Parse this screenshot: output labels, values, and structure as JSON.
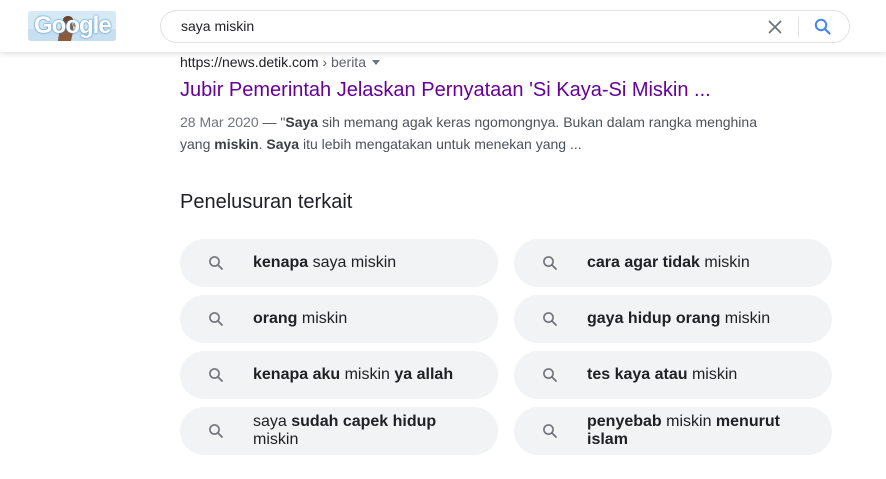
{
  "header": {
    "logo_text": "Google",
    "search_value": "saya miskin"
  },
  "result": {
    "url": "https://news.detik.com",
    "breadcrumb": " › berita",
    "title": "Jubir Pemerintah Jelaskan Pernyataan 'Si Kaya-Si Miskin ...",
    "date": "28 Mar 2020",
    "snippet_parts": [
      {
        "text": " — \"",
        "bold": false
      },
      {
        "text": "Saya",
        "bold": true
      },
      {
        "text": " sih memang agak keras ngomongnya. Bukan dalam rangka menghina yang ",
        "bold": false
      },
      {
        "text": "miskin",
        "bold": true
      },
      {
        "text": ". ",
        "bold": false
      },
      {
        "text": "Saya",
        "bold": true
      },
      {
        "text": " itu lebih mengatakan untuk menekan yang ...",
        "bold": false
      }
    ]
  },
  "related": {
    "heading": "Penelusuran terkait",
    "items": [
      {
        "parts": [
          {
            "text": "kenapa",
            "bold": true
          },
          {
            "text": " saya miskin",
            "bold": false
          }
        ]
      },
      {
        "parts": [
          {
            "text": "cara agar tidak",
            "bold": true
          },
          {
            "text": " miskin",
            "bold": false
          }
        ]
      },
      {
        "parts": [
          {
            "text": "orang",
            "bold": true
          },
          {
            "text": " miskin",
            "bold": false
          }
        ]
      },
      {
        "parts": [
          {
            "text": "gaya hidup orang",
            "bold": true
          },
          {
            "text": " miskin",
            "bold": false
          }
        ]
      },
      {
        "parts": [
          {
            "text": "kenapa aku",
            "bold": true
          },
          {
            "text": " miskin ",
            "bold": false
          },
          {
            "text": "ya allah",
            "bold": true
          }
        ]
      },
      {
        "parts": [
          {
            "text": "tes kaya atau",
            "bold": true
          },
          {
            "text": " miskin",
            "bold": false
          }
        ]
      },
      {
        "parts": [
          {
            "text": "saya ",
            "bold": false
          },
          {
            "text": "sudah capek hidup",
            "bold": true
          },
          {
            "text": " miskin",
            "bold": false
          }
        ]
      },
      {
        "parts": [
          {
            "text": "penyebab",
            "bold": true
          },
          {
            "text": " miskin ",
            "bold": false
          },
          {
            "text": "menurut islam",
            "bold": true
          }
        ]
      }
    ]
  }
}
